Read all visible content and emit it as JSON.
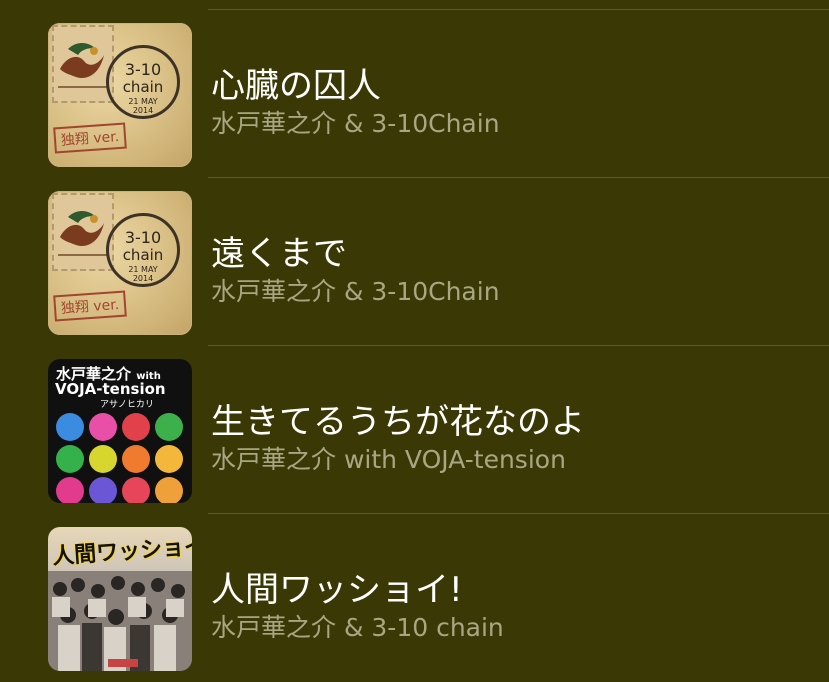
{
  "songs": [
    {
      "title": "心臓の囚人",
      "artist": "水戸華之介 & 3-10Chain",
      "artwork": {
        "kind": "stamp",
        "line1": "3-10",
        "line2": "chain",
        "line3": "21 MAY\n2014",
        "label": "独翔 ver."
      }
    },
    {
      "title": "遠くまで",
      "artist": "水戸華之介 & 3-10Chain",
      "artwork": {
        "kind": "stamp",
        "line1": "3-10",
        "line2": "chain",
        "line3": "21 MAY\n2014",
        "label": "独翔 ver."
      }
    },
    {
      "title": "生きてるうちが花なのよ",
      "artist": "水戸華之介 with VOJA-tension",
      "artwork": {
        "kind": "voja",
        "line1": "水戸華之介",
        "with": "with",
        "line2": "VOJA-tension",
        "line3": "アサノヒカリ",
        "dot_colors": [
          "#3b8be0",
          "#e94fa6",
          "#e1414a",
          "#3db04b",
          "#34b14a",
          "#d6d62e",
          "#f07a2e",
          "#f3b73c",
          "#e23b8e",
          "#6b56d6",
          "#e7455a",
          "#f0a03a"
        ]
      }
    },
    {
      "title": "人間ワッショイ!",
      "artist": "水戸華之介 & 3-10 chain",
      "artwork": {
        "kind": "wasshoi",
        "title": "人間ワッショイ!"
      }
    }
  ],
  "colors": {
    "background": "#3a3905",
    "title": "#ffffff",
    "artist": "#a9a783",
    "divider": "#5b5a2c"
  }
}
